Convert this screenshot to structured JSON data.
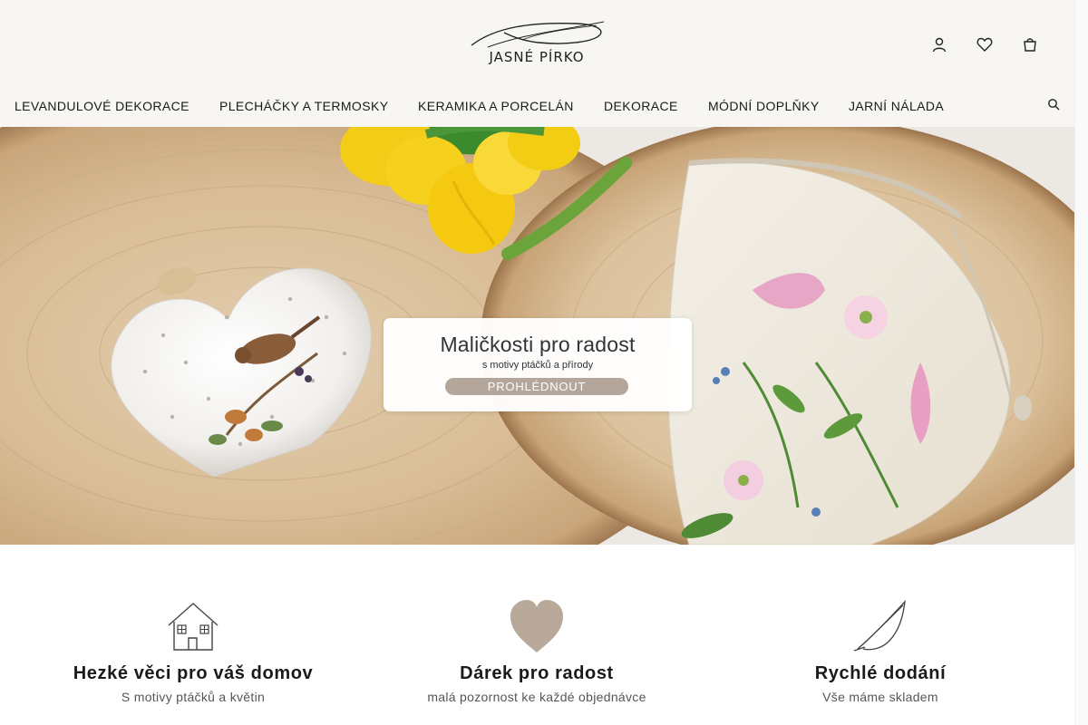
{
  "brand": {
    "name": "JASNÉ PÍRKO"
  },
  "header_icons": [
    {
      "name": "user-icon"
    },
    {
      "name": "heart-icon"
    },
    {
      "name": "cart-icon"
    }
  ],
  "nav": {
    "items": [
      {
        "label": "LEVANDULOVÉ DEKORACE"
      },
      {
        "label": "PLECHÁČKY A TERMOSKY"
      },
      {
        "label": "KERAMIKA A PORCELÁN"
      },
      {
        "label": "DEKORACE"
      },
      {
        "label": "MÓDNÍ DOPLŇKY"
      },
      {
        "label": "JARNÍ NÁLADA"
      }
    ],
    "search_icon": "search-icon"
  },
  "hero": {
    "title": "Maličkosti pro radost",
    "subtitle": "s motivy ptáčků a přírody",
    "button_label": "PROHLÉDNOUT"
  },
  "features": [
    {
      "icon": "house-icon",
      "title": "Hezké věci pro váš domov",
      "text": "S motivy ptáčků a květin"
    },
    {
      "icon": "heart-icon",
      "title": "Dárek pro radost",
      "text": "malá pozornost ke každé objednávce"
    },
    {
      "icon": "feather-icon",
      "title": "Rychlé dodání",
      "text": "Vše máme skladem"
    }
  ],
  "colors": {
    "header_bg": "#f8f6f3",
    "accent": "#b4a69a",
    "heart_fill": "#b9a99a"
  }
}
